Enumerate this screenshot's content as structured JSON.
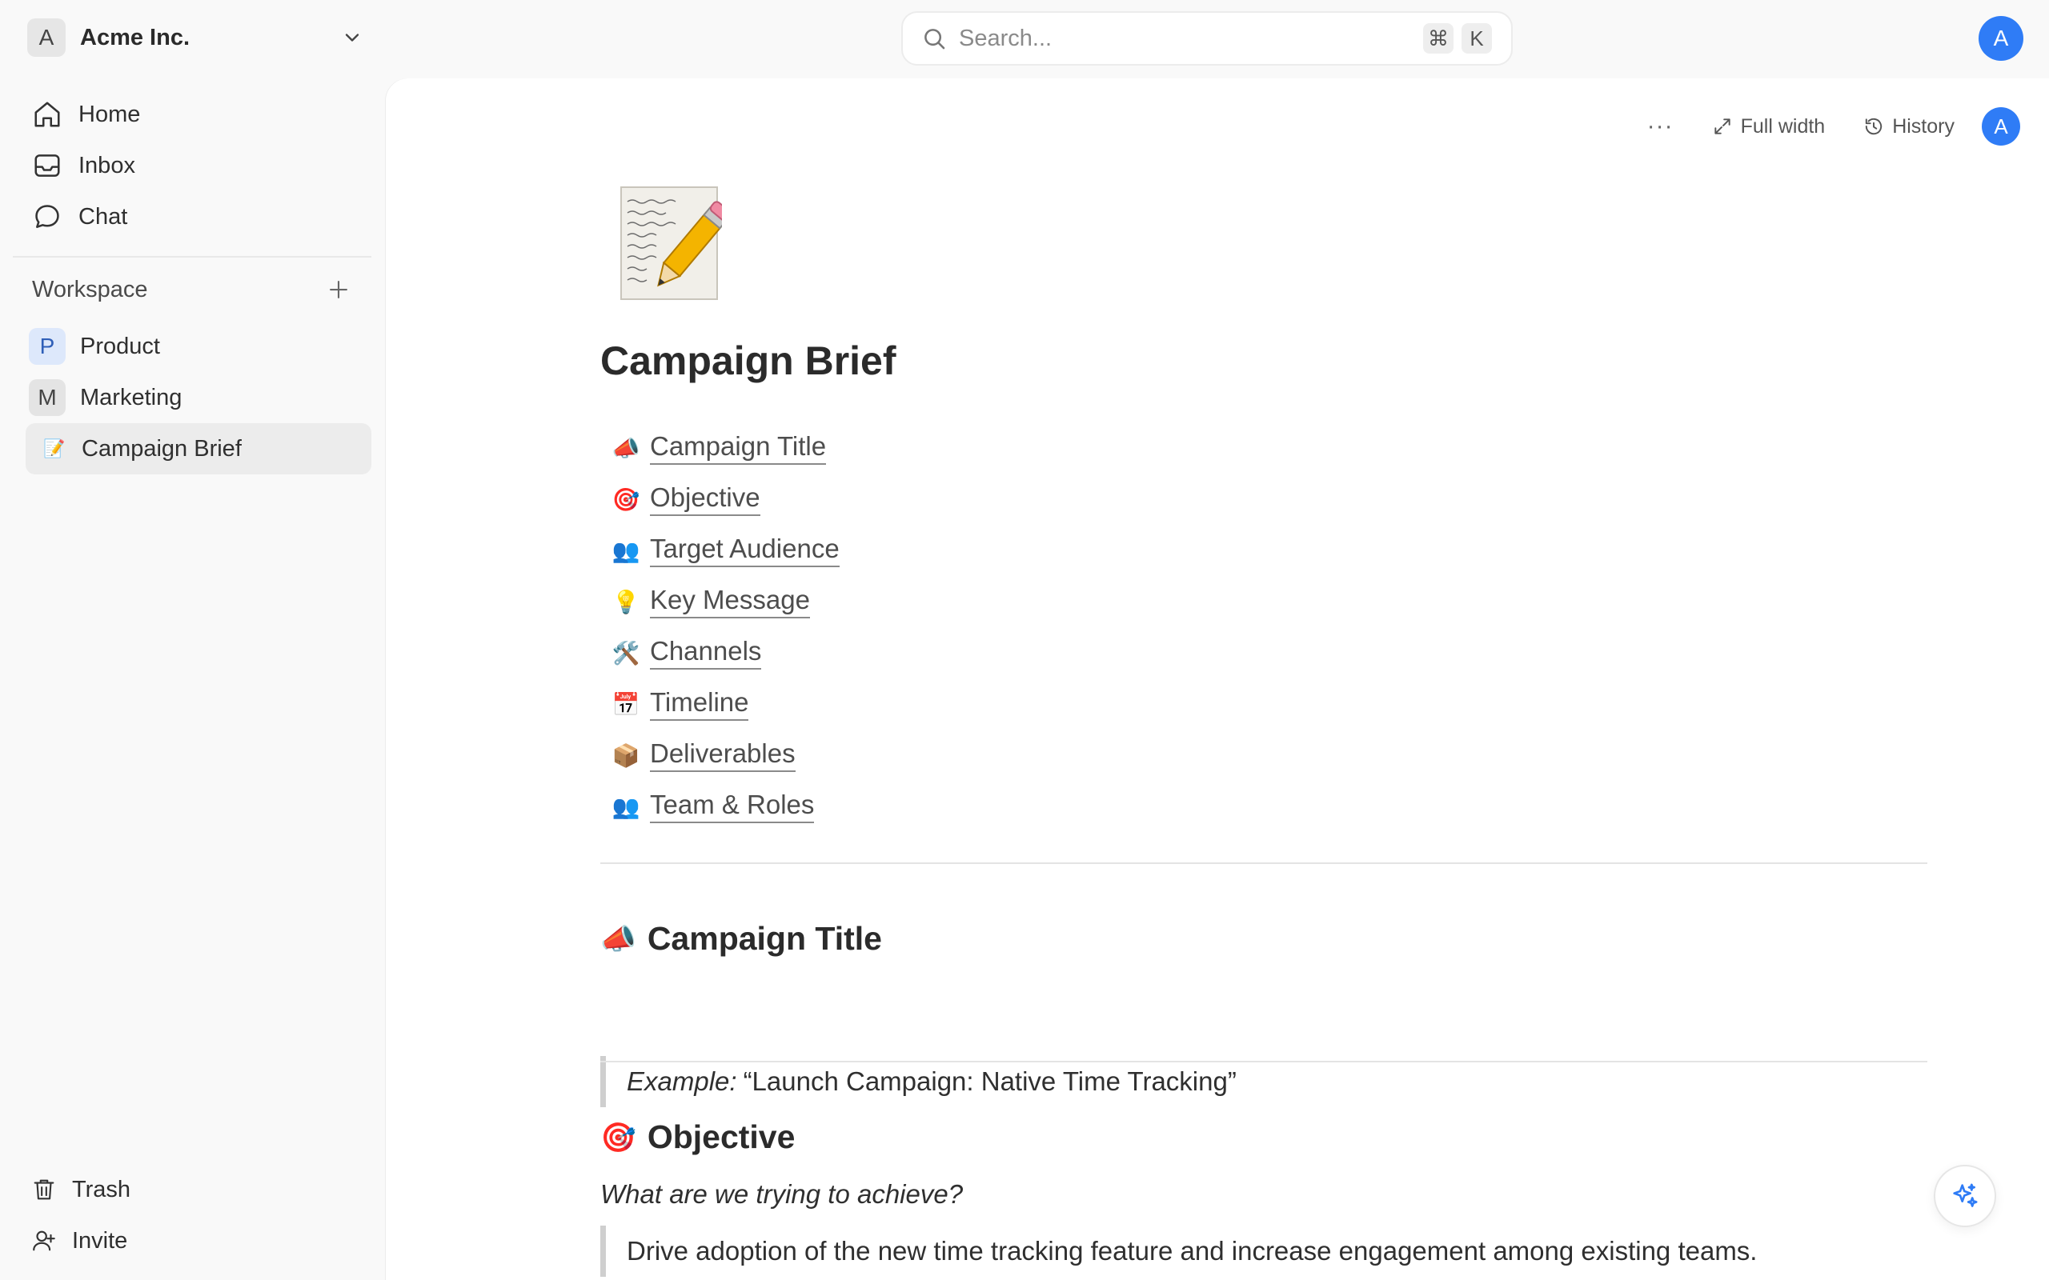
{
  "workspace_switcher": {
    "avatar_letter": "A",
    "name": "Acme Inc."
  },
  "nav": [
    {
      "label": "Home",
      "icon": "home-icon"
    },
    {
      "label": "Inbox",
      "icon": "inbox-icon"
    },
    {
      "label": "Chat",
      "icon": "chat-icon"
    }
  ],
  "workspace_section": {
    "label": "Workspace"
  },
  "pages": [
    {
      "badge": "P",
      "label": "Product",
      "badge_bg": "#dde8fb"
    },
    {
      "badge": "M",
      "label": "Marketing",
      "badge_bg": "#e4e4e4"
    },
    {
      "badge": "📝",
      "label": "Campaign Brief",
      "active": true
    }
  ],
  "bottom": [
    {
      "label": "Trash",
      "icon": "trash-icon"
    },
    {
      "label": "Invite",
      "icon": "invite-icon"
    }
  ],
  "search": {
    "placeholder": "Search...",
    "shortcut_mod": "⌘",
    "shortcut_key": "K"
  },
  "user_avatar": "A",
  "toolbar": {
    "more": "···",
    "full_width": "Full width",
    "history": "History",
    "avatar": "A"
  },
  "document": {
    "title": "Campaign Brief",
    "toc": [
      {
        "emoji": "📣",
        "label": "Campaign Title"
      },
      {
        "emoji": "🎯",
        "label": "Objective"
      },
      {
        "emoji": "👥",
        "label": "Target Audience"
      },
      {
        "emoji": "💡",
        "label": "Key Message"
      },
      {
        "emoji": "🛠️",
        "label": "Channels"
      },
      {
        "emoji": "📅",
        "label": "Timeline"
      },
      {
        "emoji": "📦",
        "label": "Deliverables"
      },
      {
        "emoji": "👥",
        "label": "Team & Roles"
      }
    ],
    "section1": {
      "emoji": "📣",
      "heading": "Campaign Title",
      "example_label": "Example:",
      "example_text": "“Launch Campaign: Native Time Tracking”"
    },
    "section2": {
      "emoji": "🎯",
      "heading": "Objective",
      "prompt": "What are we trying to achieve?",
      "quote": "Drive adoption of the new time tracking feature and increase engagement among existing teams."
    }
  },
  "colors": {
    "accent": "#2f7cf6",
    "sidebar_bg": "#f9f9f9",
    "main_bg": "#ffffff"
  }
}
